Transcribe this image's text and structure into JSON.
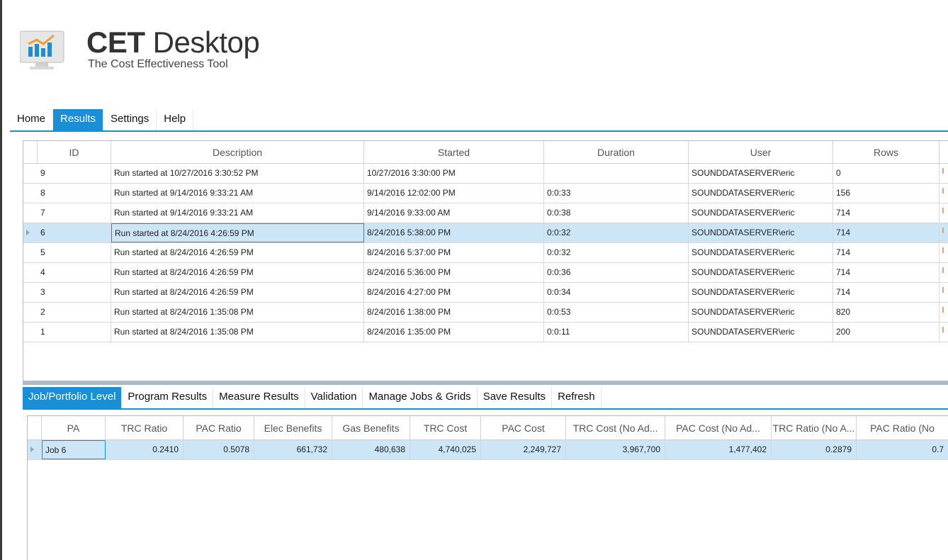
{
  "app": {
    "title_bold": "CET",
    "title_light": " Desktop",
    "subtitle": "The Cost Effectiveness Tool"
  },
  "main_tabs": [
    {
      "label": "Home",
      "active": false
    },
    {
      "label": "Results",
      "active": true
    },
    {
      "label": "Settings",
      "active": false
    },
    {
      "label": "Help",
      "active": false
    }
  ],
  "runs": {
    "columns": [
      "ID",
      "Description",
      "Started",
      "Duration",
      "User",
      "Rows"
    ],
    "rows": [
      {
        "id": "9",
        "description": "Run started at 10/27/2016 3:30:52 PM",
        "started": "10/27/2016 3:30:00 PM",
        "duration": "",
        "user": "SOUNDDATASERVER\\eric",
        "rows": "0"
      },
      {
        "id": "8",
        "description": "Run started at 9/14/2016 9:33:21 AM",
        "started": "9/14/2016 12:02:00 PM",
        "duration": "0:0:33",
        "user": "SOUNDDATASERVER\\eric",
        "rows": "156"
      },
      {
        "id": "7",
        "description": "Run started at 9/14/2016 9:33:21 AM",
        "started": "9/14/2016 9:33:00 AM",
        "duration": "0:0:38",
        "user": "SOUNDDATASERVER\\eric",
        "rows": "714"
      },
      {
        "id": "6",
        "description": "Run started at 8/24/2016 4:26:59 PM",
        "started": "8/24/2016 5:38:00 PM",
        "duration": "0:0:32",
        "user": "SOUNDDATASERVER\\eric",
        "rows": "714"
      },
      {
        "id": "5",
        "description": "Run started at 8/24/2016 4:26:59 PM",
        "started": "8/24/2016 5:37:00 PM",
        "duration": "0:0:32",
        "user": "SOUNDDATASERVER\\eric",
        "rows": "714"
      },
      {
        "id": "4",
        "description": "Run started at 8/24/2016 4:26:59 PM",
        "started": "8/24/2016 5:36:00 PM",
        "duration": "0:0:36",
        "user": "SOUNDDATASERVER\\eric",
        "rows": "714"
      },
      {
        "id": "3",
        "description": "Run started at 8/24/2016 4:26:59 PM",
        "started": "8/24/2016 4:27:00 PM",
        "duration": "0:0:34",
        "user": "SOUNDDATASERVER\\eric",
        "rows": "714"
      },
      {
        "id": "2",
        "description": "Run started at 8/24/2016 1:35:08 PM",
        "started": "8/24/2016 1:38:00 PM",
        "duration": "0:0:53",
        "user": "SOUNDDATASERVER\\eric",
        "rows": "820"
      },
      {
        "id": "1",
        "description": "Run started at 8/24/2016 1:35:08 PM",
        "started": "8/24/2016 1:35:00 PM",
        "duration": "0:0:11",
        "user": "SOUNDDATASERVER\\eric",
        "rows": "200"
      }
    ],
    "selected_id": "6"
  },
  "bottom_tabs": [
    {
      "label": "Job/Portfolio Level",
      "active": true
    },
    {
      "label": "Program Results",
      "active": false
    },
    {
      "label": "Measure Results",
      "active": false
    },
    {
      "label": "Validation",
      "active": false
    },
    {
      "label": "Manage Jobs & Grids",
      "active": false
    },
    {
      "label": "Save Results",
      "active": false
    },
    {
      "label": "Refresh",
      "active": false
    }
  ],
  "results": {
    "columns": [
      "PA",
      "TRC Ratio",
      "PAC Ratio",
      "Elec Benefits",
      "Gas Benefits",
      "TRC Cost",
      "PAC Cost",
      "TRC Cost (No Ad...",
      "PAC Cost (No Ad...",
      "TRC Ratio (No A...",
      "PAC Ratio (No"
    ],
    "row": [
      "Job 6",
      "0.2410",
      "0.5078",
      "661,732",
      "480,638",
      "4,740,025",
      "2,249,727",
      "3,967,700",
      "1,477,402",
      "0.2879",
      "0.7"
    ]
  },
  "colors": {
    "accent": "#1b8fd6",
    "selected_row": "#cde6f7"
  }
}
